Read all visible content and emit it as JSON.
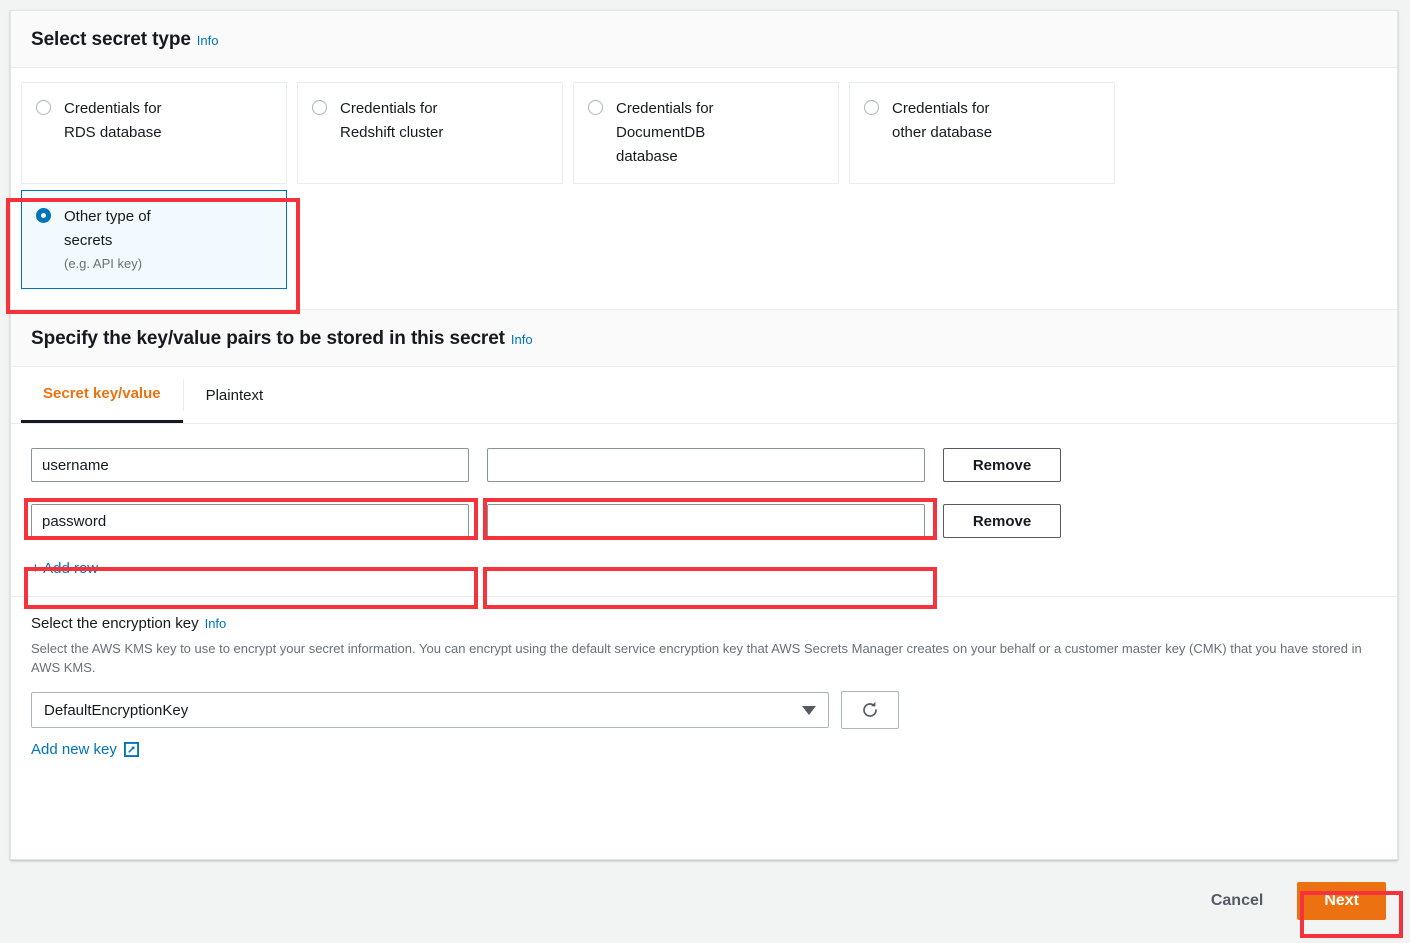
{
  "secret_type_section": {
    "title": "Select secret type",
    "info_label": "Info",
    "options": [
      {
        "label_line1": "Credentials for",
        "label_line2": "RDS database",
        "sub": "",
        "selected": false
      },
      {
        "label_line1": "Credentials for",
        "label_line2": "Redshift cluster",
        "sub": "",
        "selected": false
      },
      {
        "label_line1": "Credentials for",
        "label_line2": "DocumentDB",
        "label_line3": "database",
        "sub": "",
        "selected": false
      },
      {
        "label_line1": "Credentials for",
        "label_line2": "other database",
        "sub": "",
        "selected": false
      },
      {
        "label_line1": "Other type of",
        "label_line2": "secrets",
        "sub": "(e.g. API key)",
        "selected": true
      }
    ]
  },
  "kv_section": {
    "title": "Specify the key/value pairs to be stored in this secret",
    "info_label": "Info",
    "tabs": [
      {
        "label": "Secret key/value",
        "active": true
      },
      {
        "label": "Plaintext",
        "active": false
      }
    ],
    "rows": [
      {
        "key": "username",
        "value": "",
        "remove_label": "Remove"
      },
      {
        "key": "password",
        "value": "",
        "remove_label": "Remove"
      }
    ],
    "add_row_label": "+ Add row"
  },
  "encryption_section": {
    "title": "Select the encryption key",
    "info_label": "Info",
    "description": "Select the AWS KMS key to use to encrypt your secret information. You can encrypt using the default service encryption key that AWS Secrets Manager creates on your behalf or a customer master key (CMK) that you have stored in AWS KMS.",
    "selected_key": "DefaultEncryptionKey",
    "refresh_icon": "refresh-icon",
    "add_new_key_label": "Add new key",
    "external_link_icon": "external-link-icon"
  },
  "footer": {
    "cancel_label": "Cancel",
    "next_label": "Next"
  },
  "colors": {
    "accent_orange": "#ec7211",
    "link_blue": "#0073bb",
    "annotation_red": "#f4333d",
    "selected_card_bg": "#f1faff",
    "page_bg": "#f2f3f3"
  }
}
